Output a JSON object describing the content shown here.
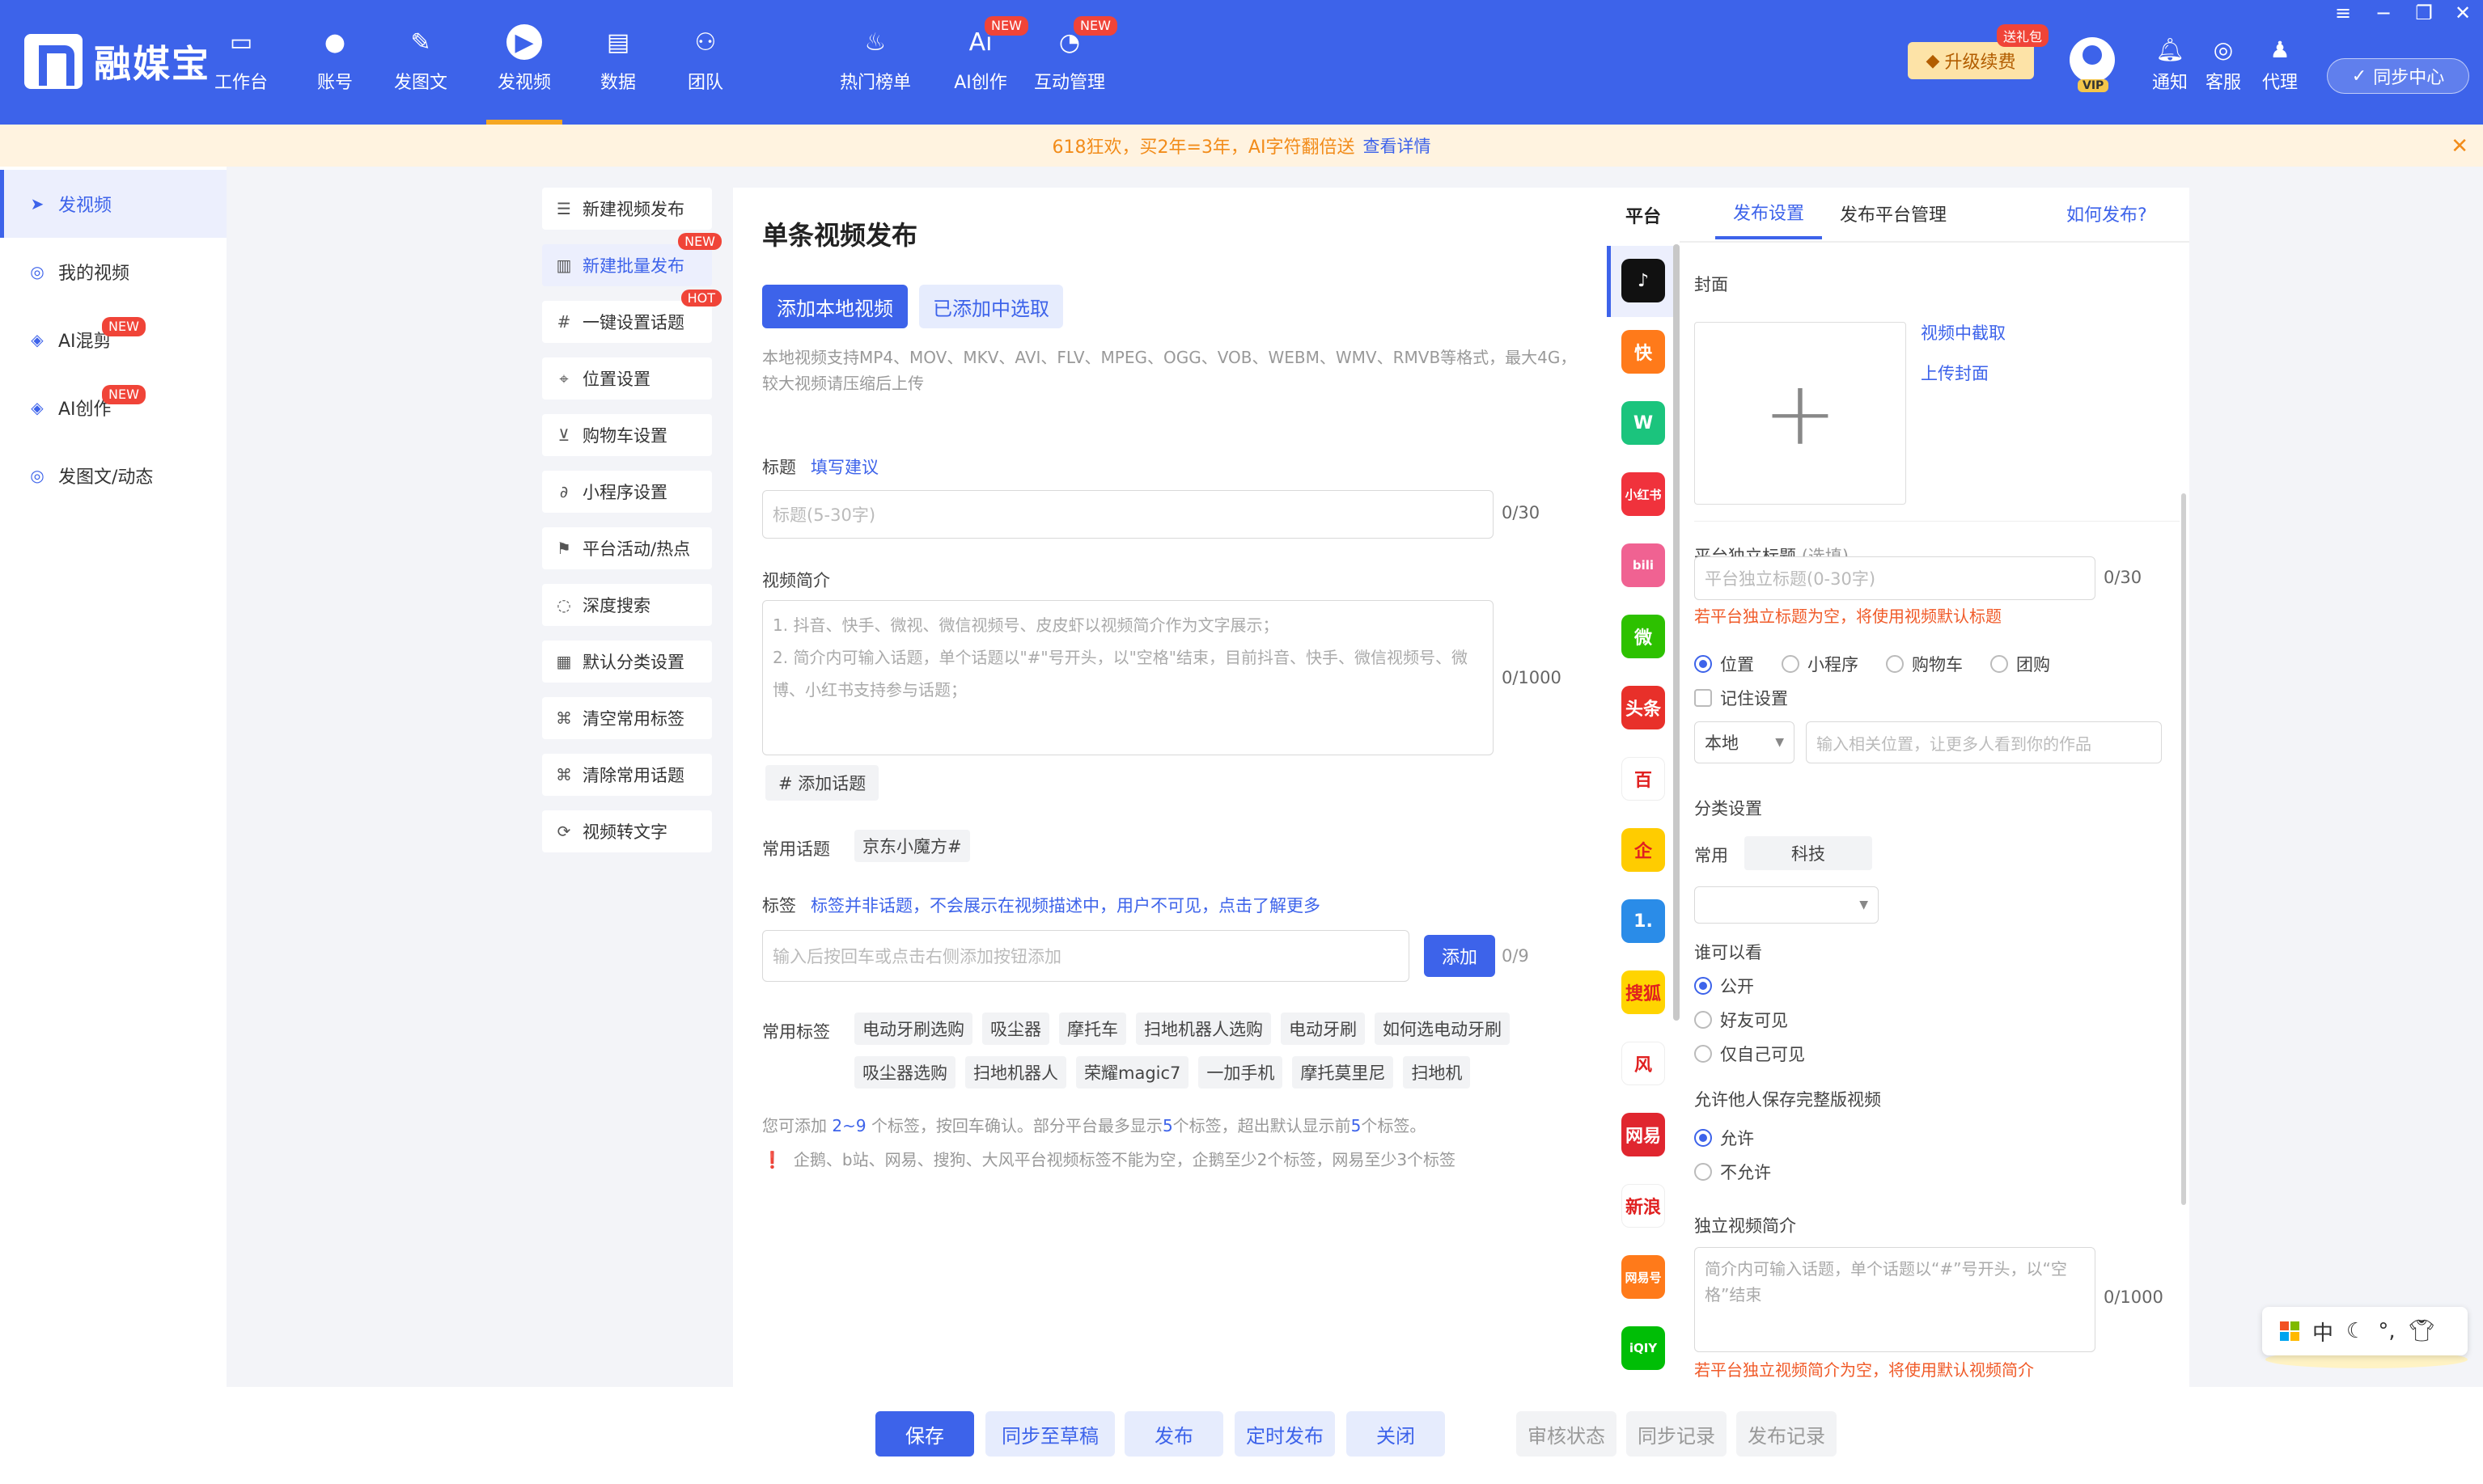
{
  "app": {
    "name": "融媒宝"
  },
  "topnav": [
    {
      "label": "工作台",
      "icon": "monitor-icon"
    },
    {
      "label": "账号",
      "icon": "user-icon"
    },
    {
      "label": "发图文",
      "icon": "feather-icon"
    },
    {
      "label": "发视频",
      "icon": "play-icon",
      "active": true
    },
    {
      "label": "数据",
      "icon": "chart-icon"
    },
    {
      "label": "团队",
      "icon": "team-icon"
    },
    {
      "label": "热门榜单",
      "icon": "flame-icon"
    },
    {
      "label": "AI创作",
      "icon": "ai-icon",
      "badge": "NEW"
    },
    {
      "label": "互动管理",
      "icon": "chat-icon",
      "badge": "NEW"
    }
  ],
  "topright": {
    "upgrade": "升级续费",
    "gift": "送礼包",
    "vip": "VIP",
    "notify": "通知",
    "service": "客服",
    "agent": "代理",
    "sync": "同步中心"
  },
  "notice": {
    "text": "618狂欢，买2年=3年，AI字符翻倍送",
    "link": "查看详情"
  },
  "leftnav": [
    {
      "label": "发视频",
      "active": true
    },
    {
      "label": "我的视频"
    },
    {
      "label": "AI混剪",
      "badge": "NEW"
    },
    {
      "label": "AI创作",
      "badge": "NEW"
    },
    {
      "label": "发图文/动态"
    }
  ],
  "subnav": [
    {
      "label": "新建视频发布"
    },
    {
      "label": "新建批量发布",
      "badge": "NEW",
      "active": true
    },
    {
      "label": "一键设置话题",
      "badge": "HOT"
    },
    {
      "label": "位置设置"
    },
    {
      "label": "购物车设置"
    },
    {
      "label": "小程序设置"
    },
    {
      "label": "平台活动/热点"
    },
    {
      "label": "深度搜索"
    },
    {
      "label": "默认分类设置"
    },
    {
      "label": "清空常用标签"
    },
    {
      "label": "清除常用话题"
    },
    {
      "label": "视频转文字"
    }
  ],
  "main": {
    "title": "单条视频发布",
    "btn_local": "添加本地视频",
    "btn_added": "已添加中选取",
    "format_hint": "本地视频支持MP4、MOV、MKV、AVI、FLV、MPEG、OGG、VOB、WEBM、WMV、RMVB等格式，最大4G，较大视频请压缩后上传",
    "title_label": "标题",
    "title_suggest": "填写建议",
    "title_placeholder": "标题(5-30字)",
    "title_count": "0/30",
    "desc_label": "视频简介",
    "desc_line1": "1. 抖音、快手、微视、微信视频号、皮皮虾以视频简介作为文字展示；",
    "desc_line2": "2. 简介内可输入话题，单个话题以\"#\"号开头，以\"空格\"结束，目前抖音、快手、微信视频号、微博、小红书支持参与话题；",
    "desc_count": "0/1000",
    "add_topic": "# 添加话题",
    "common_topic_label": "常用话题",
    "common_topic": "京东小魔方#",
    "tag_label": "标签",
    "tag_note": "标签并非话题，不会展示在视频描述中，用户不可见，点击了解更多",
    "tag_placeholder": "输入后按回车或点击右侧添加按钮添加",
    "tag_add": "添加",
    "tag_count": "0/9",
    "common_tags_label": "常用标签",
    "common_tags_row1": [
      "电动牙刷选购",
      "吸尘器",
      "摩托车",
      "扫地机器人选购",
      "电动牙刷",
      "如何选电动牙刷"
    ],
    "common_tags_row2": [
      "吸尘器选购",
      "扫地机器人",
      "荣耀magic7",
      "一加手机",
      "摩托莫里尼",
      "扫地机"
    ],
    "tag_hint_pre": "您可添加",
    "tag_hint_range": "2~9",
    "tag_hint_mid": "个标签，按回车确认。部分平台最多显示",
    "tag_hint_n1": "5",
    "tag_hint_mid2": "个标签，超出默认显示前",
    "tag_hint_n2": "5",
    "tag_hint_end": "个标签。",
    "tag_warn": "企鹅、b站、网易、搜狗、大风平台视频标签不能为空，企鹅至少2个标签，网易至少3个标签"
  },
  "platform": {
    "head": "平台",
    "items": [
      {
        "name": "douyin-icon",
        "text": "♪",
        "color": "#111111"
      },
      {
        "name": "kuaishou-icon",
        "text": "快",
        "color": "#ff7a1a"
      },
      {
        "name": "weishi-icon",
        "text": "W",
        "color": "#1bc47d"
      },
      {
        "name": "xiaohongshu-icon",
        "text": "小红书",
        "color": "#f0323c"
      },
      {
        "name": "bilibili-icon",
        "text": "bili",
        "color": "#f06292"
      },
      {
        "name": "wechat-channels-icon",
        "text": "微",
        "color": "#2dc100"
      },
      {
        "name": "toutiao-icon",
        "text": "头条",
        "color": "#e8302a"
      },
      {
        "name": "baijia-icon",
        "text": "百",
        "color": "#ffffff"
      },
      {
        "name": "qq-icon",
        "text": "企",
        "color": "#ffcc00"
      },
      {
        "name": "yidian-icon",
        "text": "1.",
        "color": "#2a8ce8"
      },
      {
        "name": "sohu-icon",
        "text": "搜狐",
        "color": "#ffd400"
      },
      {
        "name": "dafeng-icon",
        "text": "风",
        "color": "#ffffff"
      },
      {
        "name": "netease-icon",
        "text": "网易",
        "color": "#e0262f"
      },
      {
        "name": "xinlang-icon",
        "text": "新浪",
        "color": "#ffffff"
      },
      {
        "name": "zaker-icon",
        "text": "网易号",
        "color": "#ff7a1a"
      },
      {
        "name": "iqiyi-icon",
        "text": "iQIY",
        "color": "#00be06"
      }
    ]
  },
  "right": {
    "tab1": "发布设置",
    "tab2": "发布平台管理",
    "howto": "如何发布?",
    "cover_label": "封面",
    "cover_from_video": "视频中截取",
    "cover_upload": "上传封面",
    "ind_title_label": "平台独立标题",
    "ind_title_opt": "(选填)",
    "ind_title_placeholder": "平台独立标题(0-30字)",
    "ind_title_count": "0/30",
    "ind_title_warn": "若平台独立标题为空，将使用视频默认标题",
    "opt_location": "位置",
    "opt_mini": "小程序",
    "opt_cart": "购物车",
    "opt_group": "团购",
    "remember": "记住设置",
    "local_select": "本地",
    "location_placeholder": "输入相关位置，让更多人看到你的作品",
    "category_label": "分类设置",
    "category_common": "常用",
    "category_tag": "科技",
    "who_label": "谁可以看",
    "who_public": "公开",
    "who_friends": "好友可见",
    "who_self": "仅自己可见",
    "save_label": "允许他人保存完整版视频",
    "save_allow": "允许",
    "save_deny": "不允许",
    "ind_desc_label": "独立视频简介",
    "ind_desc_placeholder": "简介内可输入话题，单个话题以“#”号开头，以“空格”结束",
    "ind_desc_count": "0/1000",
    "ind_desc_warn": "若平台独立视频简介为空，将使用默认视频简介"
  },
  "bottom": {
    "save": "保存",
    "draft": "同步至草稿",
    "publish": "发布",
    "schedule": "定时发布",
    "close": "关闭",
    "review": "审核状态",
    "sync_log": "同步记录",
    "publish_log": "发布记录"
  },
  "ime": {
    "lang": "中"
  }
}
